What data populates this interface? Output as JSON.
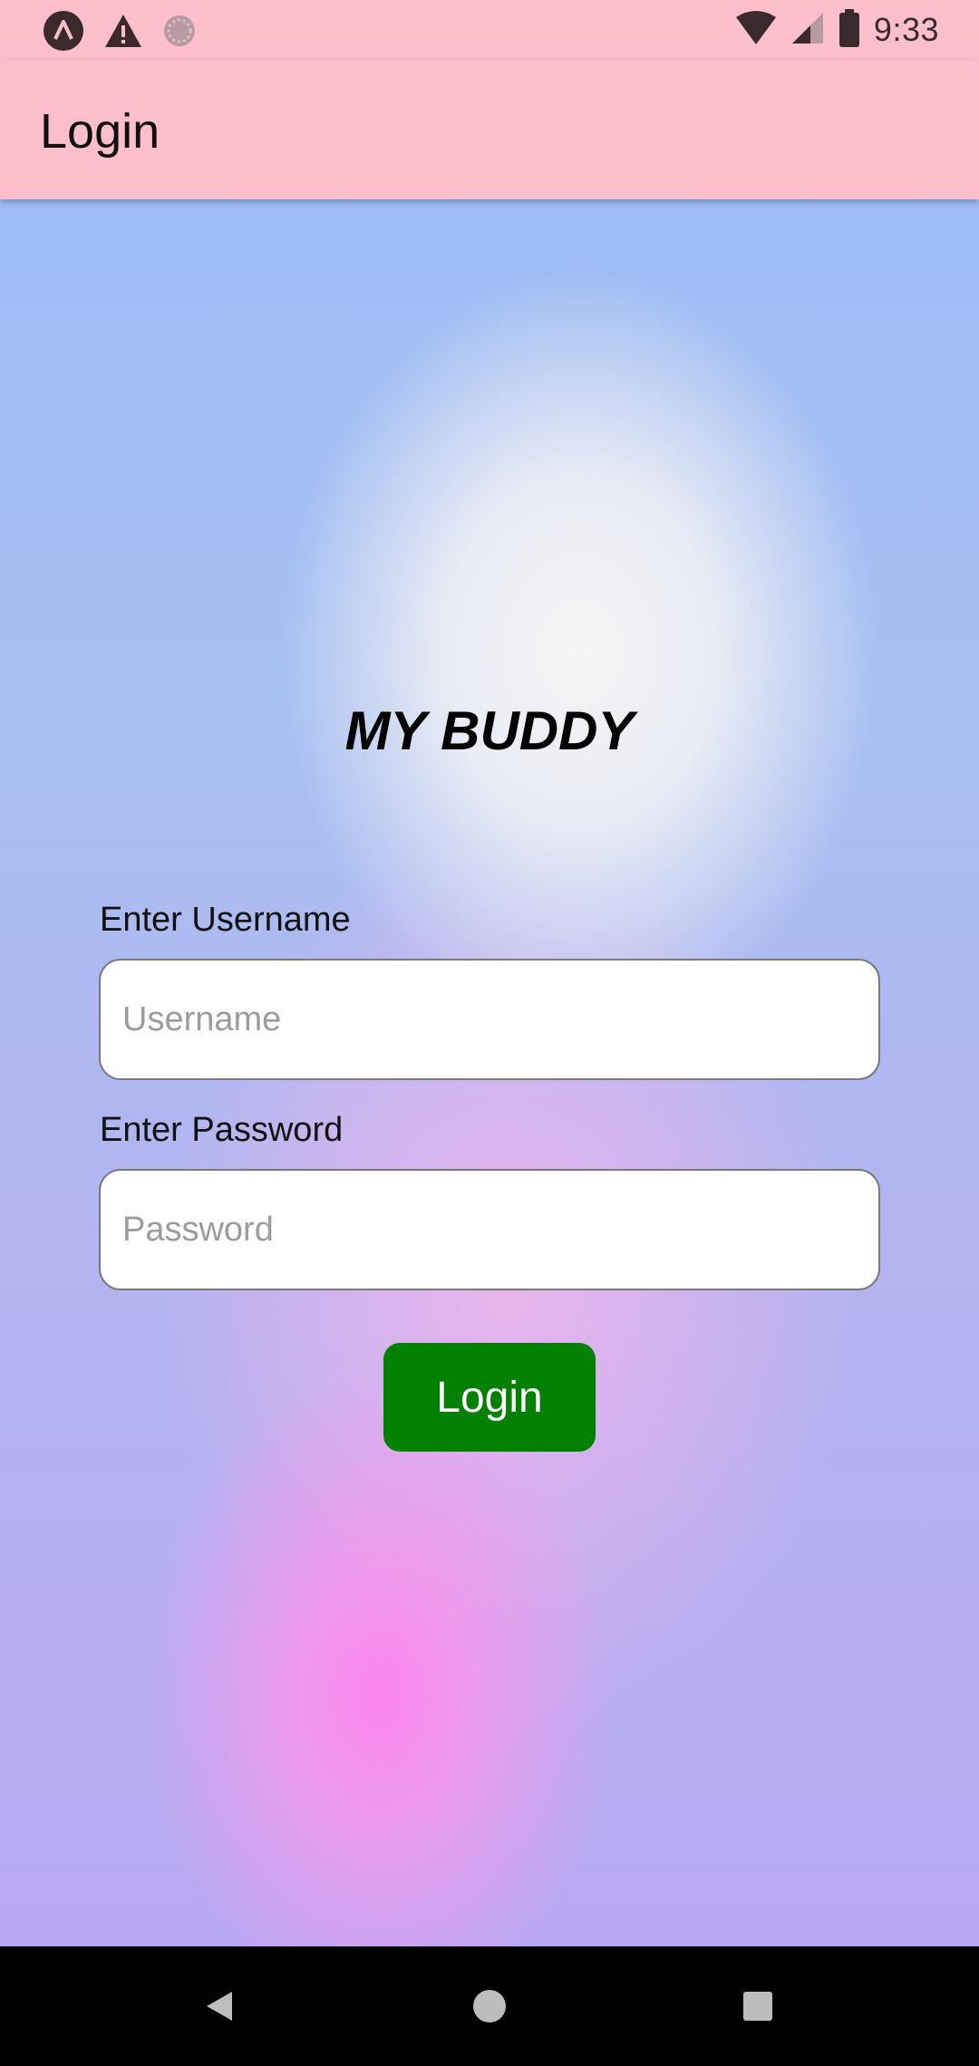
{
  "status_bar": {
    "time": "9:33",
    "left_icons": [
      "app-notification-icon",
      "warning-icon",
      "sync-icon"
    ],
    "right_icons": [
      "wifi-icon",
      "cellular-signal-icon",
      "battery-icon"
    ]
  },
  "app_bar": {
    "title": "Login",
    "background": "#fdbfcc"
  },
  "main": {
    "brand_title": "MY BUDDY",
    "username": {
      "label": "Enter Username",
      "placeholder": "Username",
      "value": ""
    },
    "password": {
      "label": "Enter Password",
      "placeholder": "Password",
      "value": ""
    },
    "login_button": {
      "label": "Login",
      "color": "#018001"
    }
  },
  "nav_bar": {
    "buttons": [
      "back-icon",
      "home-icon",
      "recents-icon"
    ]
  }
}
